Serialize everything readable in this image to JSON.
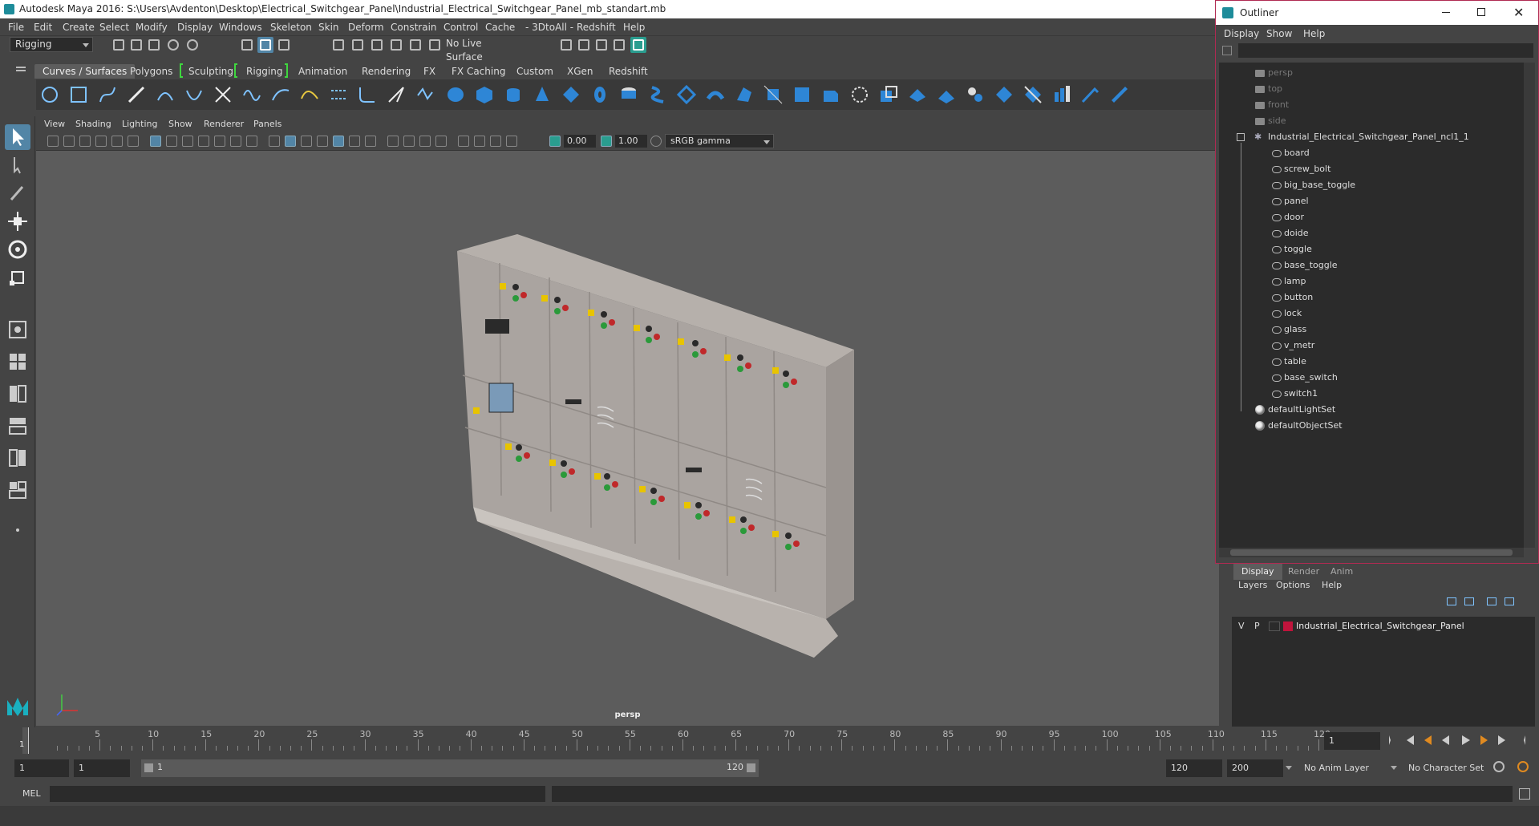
{
  "window": {
    "title": "Autodesk Maya 2016: S:\\Users\\Avdenton\\Desktop\\Electrical_Switchgear_Panel\\Industrial_Electrical_Switchgear_Panel_mb_standart.mb"
  },
  "menubar": [
    "File",
    "Edit",
    "Create",
    "Select",
    "Modify",
    "Display",
    "Windows",
    "Skeleton",
    "Skin",
    "Deform",
    "Constrain",
    "Control",
    "Cache",
    "- 3DtoAll -",
    "Redshift",
    "Help"
  ],
  "statusline": {
    "mode": "Rigging",
    "live_surface": "No Live Surface"
  },
  "shelf": {
    "tabs": [
      "Curves / Surfaces",
      "Polygons",
      "Sculpting",
      "Rigging",
      "Animation",
      "Rendering",
      "FX",
      "FX Caching",
      "Custom",
      "XGen",
      "Redshift"
    ],
    "active": "Curves / Surfaces"
  },
  "viewport": {
    "menu": [
      "View",
      "Shading",
      "Lighting",
      "Show",
      "Renderer",
      "Panels"
    ],
    "field1": "0.00",
    "field2": "1.00",
    "colorspace": "sRGB gamma",
    "camera": "persp"
  },
  "outliner": {
    "title": "Outliner",
    "menu": [
      "Display",
      "Show",
      "Help"
    ],
    "cameras": [
      "persp",
      "top",
      "front",
      "side"
    ],
    "group": "Industrial_Electrical_Switchgear_Panel_ncl1_1",
    "children": [
      "board",
      "screw_bolt",
      "big_base_toggle",
      "panel",
      "door",
      "doide",
      "toggle",
      "base_toggle",
      "lamp",
      "button",
      "lock",
      "glass",
      "v_metr",
      "table",
      "base_switch",
      "switch1"
    ],
    "sets": [
      "defaultLightSet",
      "defaultObjectSet"
    ]
  },
  "layers": {
    "tabs": [
      "Display",
      "Render",
      "Anim"
    ],
    "menu": [
      "Layers",
      "Options",
      "Help"
    ],
    "row": {
      "v": "V",
      "p": "P",
      "name": "Industrial_Electrical_Switchgear_Panel",
      "color": "#c0143c"
    }
  },
  "timeline": {
    "ticks": [
      "5",
      "10",
      "15",
      "20",
      "25",
      "30",
      "35",
      "40",
      "45",
      "50",
      "55",
      "60",
      "65",
      "70",
      "75",
      "80",
      "85",
      "90",
      "95",
      "100",
      "105",
      "110",
      "115",
      "120"
    ],
    "current": "1",
    "current_field": "1"
  },
  "range": {
    "start": "1",
    "start2": "1",
    "inner_start": "1",
    "inner_end": "120",
    "end": "120",
    "end2": "200",
    "anim_layer": "No Anim Layer",
    "char_set": "No Character Set"
  },
  "cmd": {
    "label": "MEL"
  },
  "colors": {
    "accent": "#5285a6",
    "outliner_border": "#b02a52",
    "highlight_green": "#3fd63f"
  }
}
